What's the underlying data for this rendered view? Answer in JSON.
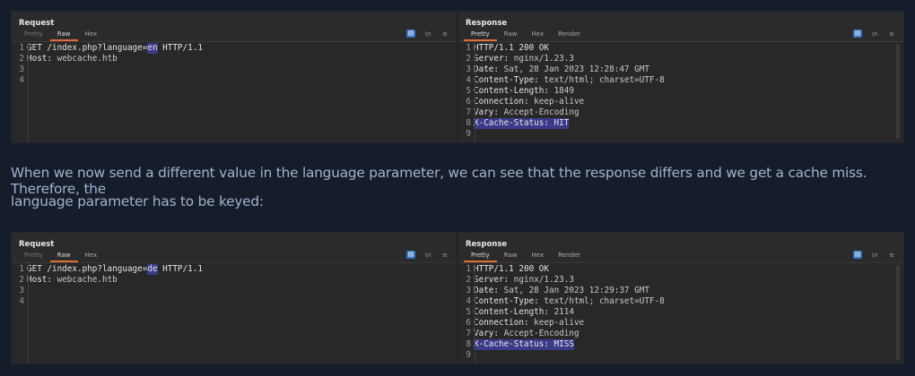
{
  "paragraph": {
    "line1": "When we now send a different value in the language parameter, we can see that the response differs and we get a cache miss. Therefore, the",
    "line2": "language parameter has to be keyed:"
  },
  "screenshots": [
    {
      "request": {
        "title": "Request",
        "tabs": [
          "Pretty",
          "Raw",
          "Hex"
        ],
        "active_tab": "Raw",
        "lines": [
          [
            [
              "k",
              "GET /index.php?language="
            ],
            [
              "hl",
              "en"
            ],
            [
              "k",
              " HTTP/1.1"
            ]
          ],
          [
            [
              "k",
              "Host: "
            ],
            [
              "v",
              "webcache.htb"
            ]
          ],
          [],
          []
        ]
      },
      "response": {
        "title": "Response",
        "tabs": [
          "Pretty",
          "Raw",
          "Hex",
          "Render"
        ],
        "active_tab": "Pretty",
        "lines": [
          [
            [
              "k",
              "HTTP/1.1 200 OK"
            ]
          ],
          [
            [
              "k",
              "Server: "
            ],
            [
              "v",
              "nginx/1.23.3"
            ]
          ],
          [
            [
              "k",
              "Date: "
            ],
            [
              "v",
              "Sat, 28 Jan 2023 12:28:47 GMT"
            ]
          ],
          [
            [
              "k",
              "Content-Type: "
            ],
            [
              "v",
              "text/html; charset=UTF-8"
            ]
          ],
          [
            [
              "k",
              "Content-Length: "
            ],
            [
              "v",
              "1849"
            ]
          ],
          [
            [
              "k",
              "Connection: "
            ],
            [
              "v",
              "keep-alive"
            ]
          ],
          [
            [
              "k",
              "Vary: "
            ],
            [
              "v",
              "Accept-Encoding"
            ]
          ],
          [
            [
              "hl",
              "X-Cache-Status: HIT"
            ]
          ],
          []
        ]
      }
    },
    {
      "request": {
        "title": "Request",
        "tabs": [
          "Pretty",
          "Raw",
          "Hex"
        ],
        "active_tab": "Raw",
        "lines": [
          [
            [
              "k",
              "GET /index.php?language="
            ],
            [
              "hl",
              "de"
            ],
            [
              "k",
              " HTTP/1.1"
            ]
          ],
          [
            [
              "k",
              "Host: "
            ],
            [
              "v",
              "webcache.htb"
            ]
          ],
          [],
          []
        ]
      },
      "response": {
        "title": "Response",
        "tabs": [
          "Pretty",
          "Raw",
          "Hex",
          "Render"
        ],
        "active_tab": "Pretty",
        "lines": [
          [
            [
              "k",
              "HTTP/1.1 200 OK"
            ]
          ],
          [
            [
              "k",
              "Server: "
            ],
            [
              "v",
              "nginx/1.23.3"
            ]
          ],
          [
            [
              "k",
              "Date: "
            ],
            [
              "v",
              "Sat, 28 Jan 2023 12:29:37 GMT"
            ]
          ],
          [
            [
              "k",
              "Content-Type: "
            ],
            [
              "v",
              "text/html; charset=UTF-8"
            ]
          ],
          [
            [
              "k",
              "Content-Length: "
            ],
            [
              "v",
              "2114"
            ]
          ],
          [
            [
              "k",
              "Connection: "
            ],
            [
              "v",
              "keep-alive"
            ]
          ],
          [
            [
              "k",
              "Vary: "
            ],
            [
              "v",
              "Accept-Encoding"
            ]
          ],
          [
            [
              "hl",
              "X-Cache-Status: MISS"
            ]
          ],
          []
        ]
      }
    }
  ],
  "icons": {
    "wrap": "▤",
    "newline": "\\n",
    "menu": "≡"
  },
  "accent": "#e0703a"
}
